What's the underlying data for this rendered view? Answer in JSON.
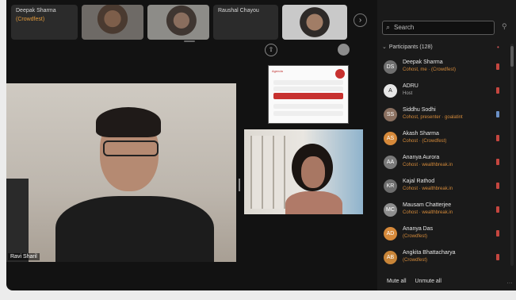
{
  "strip": {
    "tiles": [
      {
        "name": "Deepak Sharma",
        "sub": "(Crowdfest)",
        "kind": "name"
      },
      {
        "name": "",
        "sub": "",
        "kind": "video"
      },
      {
        "name": "",
        "sub": "",
        "kind": "video2"
      },
      {
        "name": "Raushal Chayou",
        "sub": "",
        "kind": "name"
      },
      {
        "name": "",
        "sub": "",
        "kind": "video3"
      }
    ],
    "arrow_glyph": "›"
  },
  "stage": {
    "main_name": "Ravi Sharil",
    "share_glyph": "⇧",
    "slide": {
      "title": "Agenda"
    }
  },
  "panel": {
    "search_placeholder": "Search",
    "section_title": "Participants (128)",
    "participants": [
      {
        "name": "Deepak Sharma",
        "role": "Cohost, me · (Crowdfest)",
        "initials": "DS",
        "flag": "red"
      },
      {
        "name": "ADRU",
        "role": "Host",
        "initials": "A",
        "flag": "red"
      },
      {
        "name": "Siddhu Sodhi",
        "role": "Cohost, presenter · goalatint",
        "initials": "SS",
        "flag": "blue"
      },
      {
        "name": "Akash Sharma",
        "role": "Cohost · (Crowdfest)",
        "initials": "AS",
        "flag": "red"
      },
      {
        "name": "Ananya Aurora",
        "role": "Cohost · wealthbreak.in",
        "initials": "AA",
        "flag": "red"
      },
      {
        "name": "Kajal Rathod",
        "role": "Cohost · wealthbreak.in",
        "initials": "KR",
        "flag": "red"
      },
      {
        "name": "Mausam Chatterjee",
        "role": "Cohost · wealthbreak.in",
        "initials": "MC",
        "flag": "red"
      },
      {
        "name": "Ananya Das",
        "role": "(Crowdfest)",
        "initials": "AD",
        "flag": "red"
      },
      {
        "name": "Angkita Bhattacharya",
        "role": "(Crowdfest)",
        "initials": "AB",
        "flag": "red"
      }
    ],
    "mute_all": "Mute all",
    "unmute_all": "Unmute all"
  },
  "colors": {
    "background": "#121212",
    "panel": "#1a1a1a",
    "accent_orange": "#d48a3a",
    "flag_red": "#c5463f"
  }
}
